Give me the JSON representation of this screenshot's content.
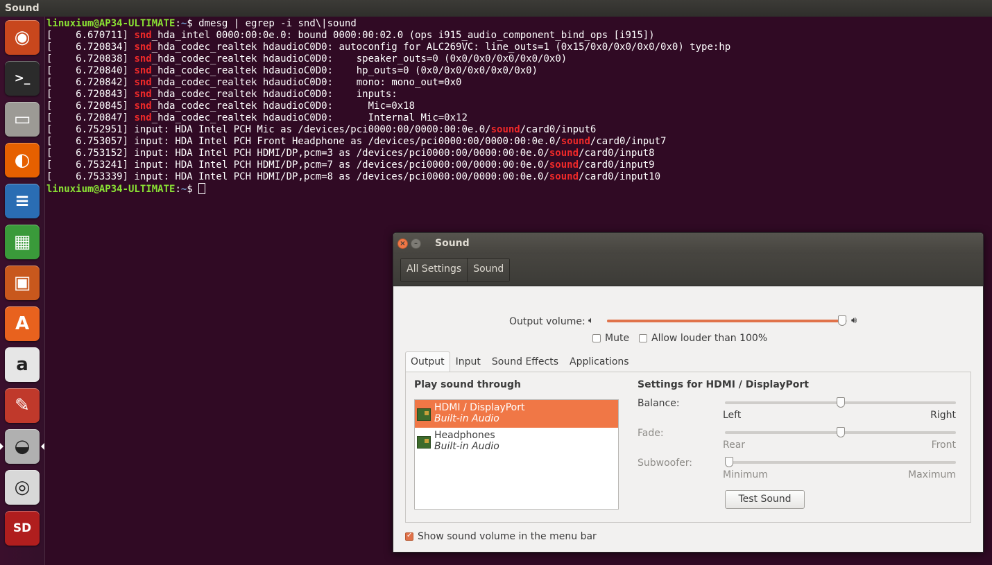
{
  "top_panel": {
    "title": "Sound"
  },
  "launcher": {
    "items": [
      {
        "name": "dash",
        "glyph": "◉",
        "color": "#c8471d"
      },
      {
        "name": "terminal",
        "glyph": ">_",
        "color": "#2b2b2b"
      },
      {
        "name": "files",
        "glyph": "▭",
        "color": "#9c9a95"
      },
      {
        "name": "firefox",
        "glyph": "◐",
        "color": "#e66000"
      },
      {
        "name": "writer",
        "glyph": "≡",
        "color": "#2a6db3"
      },
      {
        "name": "calc",
        "glyph": "▦",
        "color": "#3a9a3a"
      },
      {
        "name": "impress",
        "glyph": "▣",
        "color": "#c8581d"
      },
      {
        "name": "software-center",
        "glyph": "A",
        "color": "#e8621e"
      },
      {
        "name": "amazon",
        "glyph": "a",
        "color": "#e6e6e6"
      },
      {
        "name": "system-settings",
        "glyph": "✎",
        "color": "#c0392b"
      },
      {
        "name": "sound-settings",
        "glyph": "◒",
        "color": "#b0b0b0"
      },
      {
        "name": "camera",
        "glyph": "◎",
        "color": "#d8d8d8"
      },
      {
        "name": "sd-card",
        "glyph": "SD",
        "color": "#b01e1e"
      }
    ]
  },
  "terminal": {
    "lines": [
      [
        {
          "t": "linuxium@AP34-ULTIMATE",
          "c": "prompt-user"
        },
        {
          "t": ":",
          "c": ""
        },
        {
          "t": "~",
          "c": "prompt-path"
        },
        {
          "t": "$ dmesg | egrep -i snd\\|sound",
          "c": ""
        }
      ],
      [
        {
          "t": "[    6.670711] ",
          "c": ""
        },
        {
          "t": "snd",
          "c": "hl"
        },
        {
          "t": "_hda_intel 0000:00:0e.0: bound 0000:00:02.0 (ops i915_audio_component_bind_ops [i915])",
          "c": ""
        }
      ],
      [
        {
          "t": "[    6.720834] ",
          "c": ""
        },
        {
          "t": "snd",
          "c": "hl"
        },
        {
          "t": "_hda_codec_realtek hdaudioC0D0: autoconfig for ALC269VC: line_outs=1 (0x15/0x0/0x0/0x0/0x0) type:hp",
          "c": ""
        }
      ],
      [
        {
          "t": "[    6.720838] ",
          "c": ""
        },
        {
          "t": "snd",
          "c": "hl"
        },
        {
          "t": "_hda_codec_realtek hdaudioC0D0:    speaker_outs=0 (0x0/0x0/0x0/0x0/0x0)",
          "c": ""
        }
      ],
      [
        {
          "t": "[    6.720840] ",
          "c": ""
        },
        {
          "t": "snd",
          "c": "hl"
        },
        {
          "t": "_hda_codec_realtek hdaudioC0D0:    hp_outs=0 (0x0/0x0/0x0/0x0/0x0)",
          "c": ""
        }
      ],
      [
        {
          "t": "[    6.720842] ",
          "c": ""
        },
        {
          "t": "snd",
          "c": "hl"
        },
        {
          "t": "_hda_codec_realtek hdaudioC0D0:    mono: mono_out=0x0",
          "c": ""
        }
      ],
      [
        {
          "t": "[    6.720843] ",
          "c": ""
        },
        {
          "t": "snd",
          "c": "hl"
        },
        {
          "t": "_hda_codec_realtek hdaudioC0D0:    inputs:",
          "c": ""
        }
      ],
      [
        {
          "t": "[    6.720845] ",
          "c": ""
        },
        {
          "t": "snd",
          "c": "hl"
        },
        {
          "t": "_hda_codec_realtek hdaudioC0D0:      Mic=0x18",
          "c": ""
        }
      ],
      [
        {
          "t": "[    6.720847] ",
          "c": ""
        },
        {
          "t": "snd",
          "c": "hl"
        },
        {
          "t": "_hda_codec_realtek hdaudioC0D0:      Internal Mic=0x12",
          "c": ""
        }
      ],
      [
        {
          "t": "[    6.752951] input: HDA Intel PCH Mic as /devices/pci0000:00/0000:00:0e.0/",
          "c": ""
        },
        {
          "t": "sound",
          "c": "hl"
        },
        {
          "t": "/card0/input6",
          "c": ""
        }
      ],
      [
        {
          "t": "[    6.753057] input: HDA Intel PCH Front Headphone as /devices/pci0000:00/0000:00:0e.0/",
          "c": ""
        },
        {
          "t": "sound",
          "c": "hl"
        },
        {
          "t": "/card0/input7",
          "c": ""
        }
      ],
      [
        {
          "t": "[    6.753152] input: HDA Intel PCH HDMI/DP,pcm=3 as /devices/pci0000:00/0000:00:0e.0/",
          "c": ""
        },
        {
          "t": "sound",
          "c": "hl"
        },
        {
          "t": "/card0/input8",
          "c": ""
        }
      ],
      [
        {
          "t": "[    6.753241] input: HDA Intel PCH HDMI/DP,pcm=7 as /devices/pci0000:00/0000:00:0e.0/",
          "c": ""
        },
        {
          "t": "sound",
          "c": "hl"
        },
        {
          "t": "/card0/input9",
          "c": ""
        }
      ],
      [
        {
          "t": "[    6.753339] input: HDA Intel PCH HDMI/DP,pcm=8 as /devices/pci0000:00/0000:00:0e.0/",
          "c": ""
        },
        {
          "t": "sound",
          "c": "hl"
        },
        {
          "t": "/card0/input10",
          "c": ""
        }
      ],
      [
        {
          "t": "linuxium@AP34-ULTIMATE",
          "c": "prompt-user"
        },
        {
          "t": ":",
          "c": ""
        },
        {
          "t": "~",
          "c": "prompt-path"
        },
        {
          "t": "$ ",
          "c": ""
        }
      ]
    ]
  },
  "sound_window": {
    "title": "Sound",
    "breadcrumbs": [
      "All Settings",
      "Sound"
    ],
    "output_volume_label": "Output volume:",
    "output_volume_level": 0.98,
    "mute_label": "Mute",
    "mute_checked": false,
    "louder_label": "Allow louder than 100%",
    "louder_checked": false,
    "tabs": [
      "Output",
      "Input",
      "Sound Effects",
      "Applications"
    ],
    "play_through_heading": "Play sound through",
    "devices": [
      {
        "name": "HDMI / DisplayPort",
        "sub": "Built-in Audio",
        "selected": true
      },
      {
        "name": "Headphones",
        "sub": "Built-in Audio",
        "selected": false
      }
    ],
    "settings_heading": "Settings for HDMI / DisplayPort",
    "balance": {
      "label": "Balance:",
      "left": "Left",
      "right": "Right",
      "level": 0.5
    },
    "fade": {
      "label": "Fade:",
      "left": "Rear",
      "right": "Front",
      "level": 0.5
    },
    "subwoofer": {
      "label": "Subwoofer:",
      "left": "Minimum",
      "right": "Maximum",
      "level": 0.0
    },
    "test_button": "Test Sound",
    "show_volume_label": "Show sound volume in the menu bar",
    "show_volume_checked": true
  }
}
